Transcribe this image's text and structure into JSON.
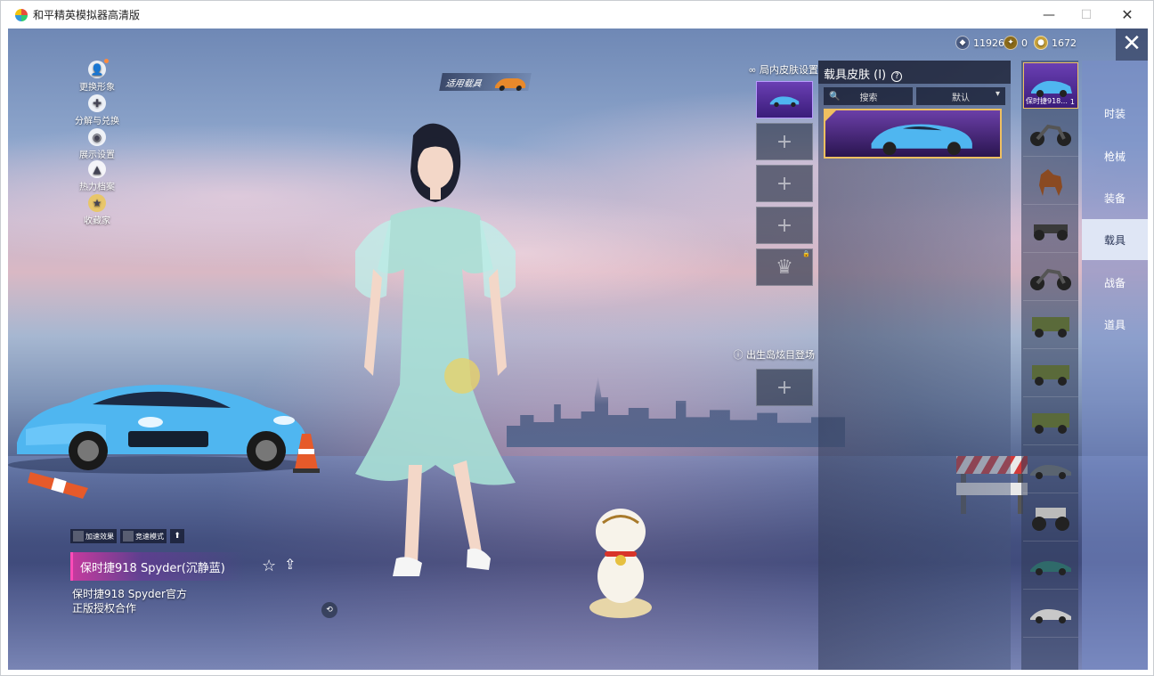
{
  "window": {
    "title": "和平精英模拟器高清版",
    "minimize": "—",
    "maximize": "☐",
    "close": "✕"
  },
  "currency": [
    {
      "icon": "points-coin-icon",
      "value": "11926"
    },
    {
      "icon": "gold-medal-icon",
      "value": "0"
    },
    {
      "icon": "gold-coin-icon",
      "value": "1672"
    }
  ],
  "left_menu": [
    {
      "icon": "avatar-icon",
      "label": "更换形象"
    },
    {
      "icon": "puzzle-icon",
      "label": "分解与兑换"
    },
    {
      "icon": "eye-icon",
      "label": "展示设置"
    },
    {
      "icon": "flame-icon",
      "label": "热力档案"
    },
    {
      "icon": "badge-icon",
      "label": "收藏家"
    }
  ],
  "vehicle_tag": "适用载具",
  "slots": {
    "title": "局内皮肤设置",
    "plus": "+",
    "crown": "♛",
    "entry_title": "出生岛炫目登场"
  },
  "skin_panel": {
    "title": "载具皮肤 (I)",
    "help": "?",
    "search_placeholder": "搜索",
    "sort_label": "默认"
  },
  "car_list": {
    "selected_name": "保时捷918...",
    "selected_count": "1",
    "items": [
      "sports-car",
      "motorcycle",
      "horse",
      "buggy",
      "motorcycle",
      "jeep",
      "jeep",
      "jeep",
      "sedan",
      "monster-truck",
      "coupe",
      "coupe"
    ]
  },
  "tabs": [
    "时装",
    "枪械",
    "装备",
    "载具",
    "战备",
    "道具"
  ],
  "active_tab": "载具",
  "mode_buttons": [
    "加速效果",
    "竞速模式"
  ],
  "skin_name": "保时捷918 Spyder(沉静蓝)",
  "license_text": [
    "保时捷918 Spyder官方",
    "正版授权合作"
  ],
  "colors": {
    "car_blue": "#4fb6f0",
    "accent_gold": "#f0c060",
    "purple": "#6a3fb3",
    "pink": "#c43a9e"
  }
}
